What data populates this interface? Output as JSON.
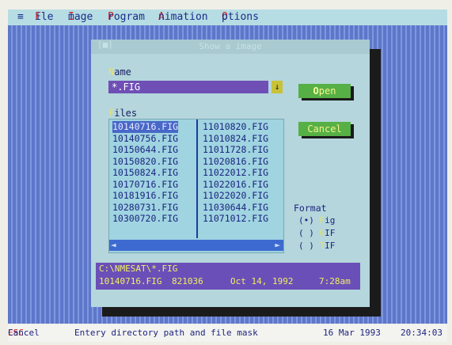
{
  "menu": {
    "system": "≡",
    "items": [
      {
        "hot": "F",
        "rest": "ile"
      },
      {
        "hot": "I",
        "rest": "mage"
      },
      {
        "hot": "P",
        "rest": "rogram"
      },
      {
        "hot": "A",
        "rest": "nimation"
      },
      {
        "hot": "O",
        "rest": "ptions"
      }
    ]
  },
  "dialog": {
    "close": "[■]",
    "title": "Show a image",
    "name_label_hot": "N",
    "name_label_rest": "ame",
    "name_value": "*.FIG",
    "name_dropdown": "↓",
    "open_hot": "O",
    "open_rest": "pen",
    "cancel_label": "Cancel",
    "files_label_hot": "F",
    "files_label_rest": "iles",
    "files_col1": [
      "10140716.FIG",
      "10140756.FIG",
      "10150644.FIG",
      "10150820.FIG",
      "10150824.FIG",
      "10170716.FIG",
      "10181916.FIG",
      "10280731.FIG",
      "10300720.FIG"
    ],
    "files_col2": [
      "11010820.FIG",
      "11010824.FIG",
      "11011728.FIG",
      "11020816.FIG",
      "11022012.FIG",
      "11022016.FIG",
      "11022020.FIG",
      "11030644.FIG",
      "11071012.FIG"
    ],
    "scroll_left": "◄",
    "scroll_right": "►",
    "format_title": "Format",
    "formats": [
      {
        "mark": "(•)",
        "hot": "F",
        "rest": "ig"
      },
      {
        "mark": "( )",
        "hot": "G",
        "rest": "IF"
      },
      {
        "mark": "( )",
        "hot": "T",
        "rest": "IF"
      }
    ],
    "info_path": "C:\\NMESAT\\*.FIG",
    "info_file": "10140716.FIG",
    "info_size": "821036",
    "info_date": "Oct 14, 1992",
    "info_time": "7:28am"
  },
  "status": {
    "esc": "ESC",
    "cancel": "Cancel",
    "hint": "Entery directory path and file mask",
    "date": "16 Mar 1993",
    "time": "20:34:03"
  }
}
